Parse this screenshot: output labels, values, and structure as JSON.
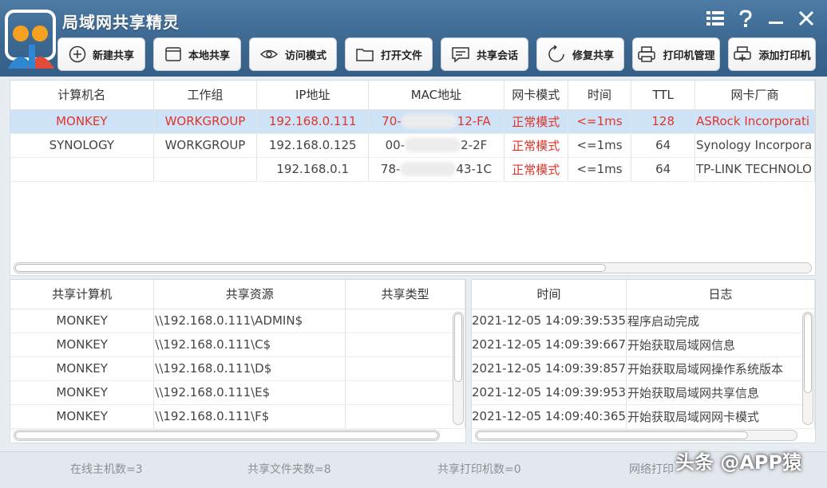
{
  "app": {
    "title": "局域网共享精灵"
  },
  "toolbar": {
    "new_share": "新建共享",
    "local_share": "本地共享",
    "access_mode": "访问模式",
    "open_file": "打开文件",
    "share_session": "共享会话",
    "repair_share": "修复共享",
    "printer_manage": "打印机管理",
    "add_printer": "添加打印机"
  },
  "hosts": {
    "columns": [
      "计算机名",
      "工作组",
      "IP地址",
      "MAC地址",
      "网卡模式",
      "时间",
      "TTL",
      "网卡厂商"
    ],
    "rows": [
      {
        "name": "MONKEY",
        "group": "WORKGROUP",
        "ip": "192.168.0.111",
        "mac_a": "70-",
        "mac_b": "12-FA",
        "mode": "正常模式",
        "time": "<=1ms",
        "ttl": "128",
        "vendor": "ASRock Incorporati"
      },
      {
        "name": "SYNOLOGY",
        "group": "WORKGROUP",
        "ip": "192.168.0.125",
        "mac_a": "00-",
        "mac_b": "2-2F",
        "mode": "正常模式",
        "time": "<=1ms",
        "ttl": "64",
        "vendor": "Synology Incorpora"
      },
      {
        "name": "",
        "group": "",
        "ip": "192.168.0.1",
        "mac_a": "78-",
        "mac_b": "43-1C",
        "mode": "正常模式",
        "time": "<=1ms",
        "ttl": "64",
        "vendor": "TP-LINK TECHNOLO"
      }
    ]
  },
  "shares": {
    "columns": [
      "共享计算机",
      "共享资源",
      "共享类型"
    ],
    "rows": [
      {
        "host": "MONKEY",
        "path": "\\\\192.168.0.111\\ADMIN$",
        "type": ""
      },
      {
        "host": "MONKEY",
        "path": "\\\\192.168.0.111\\C$",
        "type": ""
      },
      {
        "host": "MONKEY",
        "path": "\\\\192.168.0.111\\D$",
        "type": ""
      },
      {
        "host": "MONKEY",
        "path": "\\\\192.168.0.111\\E$",
        "type": ""
      },
      {
        "host": "MONKEY",
        "path": "\\\\192.168.0.111\\F$",
        "type": ""
      }
    ]
  },
  "logs": {
    "columns": [
      "时间",
      "日志"
    ],
    "rows": [
      {
        "time": "2021-12-05 14:09:39:535",
        "msg": "程序启动完成"
      },
      {
        "time": "2021-12-05 14:09:39:667",
        "msg": "开始获取局域网信息"
      },
      {
        "time": "2021-12-05 14:09:39:857",
        "msg": "开始获取局域网操作系统版本"
      },
      {
        "time": "2021-12-05 14:09:39:953",
        "msg": "开始获取局域网共享信息"
      },
      {
        "time": "2021-12-05 14:09:40:365",
        "msg": "开始获取局域网网卡模式"
      }
    ]
  },
  "status": {
    "online_hosts": "在线主机数=3",
    "shared_folders": "共享文件夹数=8",
    "shared_printers": "共享打印机数=0",
    "network_printers": "网络打印"
  },
  "watermark": "头条 @APP猿",
  "colors": {
    "title_bar": "#3a6690",
    "selected_row": "#cfe3f7",
    "highlight_text": "#e0342a"
  }
}
